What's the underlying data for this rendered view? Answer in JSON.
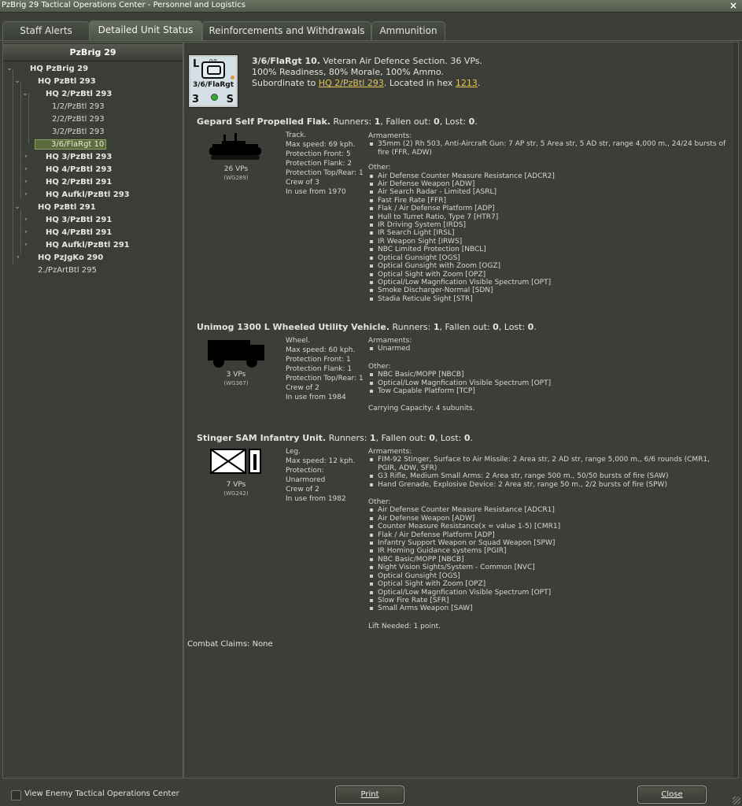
{
  "window": {
    "title": "PzBrig 29 Tactical Operations Center - Personnel and Logistics",
    "close": "×"
  },
  "tabs": [
    {
      "label": "Staff Alerts"
    },
    {
      "label": "Detailed Unit Status"
    },
    {
      "label": "Reinforcements and Withdrawals"
    },
    {
      "label": "Ammunition"
    }
  ],
  "tree": {
    "header": "PzBrig 29",
    "items": [
      {
        "label": "HQ PzBrig 29"
      },
      {
        "label": "HQ PzBtl 293"
      },
      {
        "label": "HQ 2/PzBtl 293"
      },
      {
        "label": "1/2/PzBtl 293"
      },
      {
        "label": "2/2/PzBtl 293"
      },
      {
        "label": "3/2/PzBtl 293"
      },
      {
        "label": "3/6/FlaRgt 10"
      },
      {
        "label": "HQ 3/PzBtl 293"
      },
      {
        "label": "HQ 4/PzBtl 293"
      },
      {
        "label": "HQ 2/PzBtl 291"
      },
      {
        "label": "HQ Aufkl/PzBtl 293"
      },
      {
        "label": "HQ PzBtl 291"
      },
      {
        "label": "HQ 3/PzBtl 291"
      },
      {
        "label": "HQ 4/PzBtl 291"
      },
      {
        "label": "HQ Aufkl/PzBtl 291"
      },
      {
        "label": "HQ PzJgKo 290"
      },
      {
        "label": "2./PzArtBtl 295"
      }
    ]
  },
  "unit": {
    "counter": {
      "top_left": "L",
      "name": "3/6/FlaRgt",
      "bottom_left": "3",
      "bottom_right": "S",
      "dots": "oo"
    },
    "name": "3/6/FlaRgt 10.",
    "desc": " Veteran Air Defence Section. 36 VPs.",
    "status": "100% Readiness, 80% Morale, 100% Ammo.",
    "subordinate_prefix": "Subordinate to ",
    "parent_link": "HQ 2/PzBtl 293",
    "hex_prefix": ". Located in hex ",
    "hex_link": "1213",
    "hex_suffix": "."
  },
  "vehicles": [
    {
      "name": "Gepard Self Propelled Flak.",
      "runners_label": " Runners: ",
      "runners": "1",
      "fallen_label": ", Fallen out: ",
      "fallen": "0",
      "lost_label": ", Lost: ",
      "lost": "0",
      "end": ".",
      "vps": "26 VPs",
      "wg": "(WG289)",
      "specs": [
        "Track.",
        "Max speed: 69 kph.",
        "Protection Front: 5",
        "Protection Flank: 2",
        "Protection Top/Rear: 1",
        "Crew of 3",
        "In use from 1970"
      ],
      "armaments_label": "Armaments:",
      "armaments": [
        "35mm (2) Rh 503, Anti-Aircraft Gun: 7 AP str, 5 Area str, 5 AD str, range 4,000 m., 24/24 bursts of fire (FFR, ADW)"
      ],
      "other_label": "Other:",
      "other": [
        "Air Defense Counter Measure Resistance [ADCR2]",
        "Air Defense Weapon [ADW]",
        "Air Search Radar - Limited [ASRL]",
        "Fast Fire Rate [FFR]",
        "Flak / Air Defense Platform [ADP]",
        "Hull to Turret Ratio, Type 7 [HTR7]",
        "IR Driving System [IRDS]",
        "IR Search Light [IRSL]",
        "IR Weapon Sight [IRWS]",
        "NBC Limited Protection [NBCL]",
        "Optical Gunsight [OGS]",
        "Optical Gunsight with Zoom [OGZ]",
        "Optical Sight with Zoom [OPZ]",
        "Optical/Low Magnfication Visible Spectrum [OPT]",
        "Smoke Discharger-Normal [SDN]",
        "Stadia Reticule Sight [STR]"
      ]
    },
    {
      "name": "Unimog 1300 L Wheeled Utility Vehicle.",
      "runners_label": " Runners: ",
      "runners": "1",
      "fallen_label": ", Fallen out: ",
      "fallen": "0",
      "lost_label": ", Lost: ",
      "lost": "0",
      "end": ".",
      "vps": "3 VPs",
      "wg": "(WG367)",
      "specs": [
        "Wheel.",
        "Max speed: 60 kph.",
        "Protection Front: 1",
        "Protection Flank: 1",
        "Protection Top/Rear: 1",
        "Crew of 2",
        "In use from 1984"
      ],
      "armaments_label": "Armaments:",
      "armaments": [
        "Unarmed"
      ],
      "other_label": "Other:",
      "other": [
        "NBC Basic/MOPP [NBCB]",
        "Optical/Low Magnfication Visible Spectrum [OPT]",
        "Tow Capable Platform [TCP]"
      ],
      "extra": "Carrying Capacity: 4 subunits."
    },
    {
      "name": "Stinger SAM Infantry Unit.",
      "runners_label": " Runners: ",
      "runners": "1",
      "fallen_label": ", Fallen out: ",
      "fallen": "0",
      "lost_label": ", Lost: ",
      "lost": "0",
      "end": ".",
      "vps": "7 VPs",
      "wg": "(WG242)",
      "specs": [
        "Leg.",
        "Max speed: 12 kph.",
        "Protection: Unarmored",
        "Crew of 2",
        "In use from 1982"
      ],
      "armaments_label": "Armaments:",
      "armaments": [
        "FIM-92 Stinger, Surface to Air Missile: 2 Area str, 2 AD str, range 5,000 m., 6/6 rounds (CMR1, PGIR, ADW, SFR)",
        "G3 Rifle, Medium Small Arms: 2 Area str, range 500 m., 50/50 bursts of fire (SAW)",
        "Hand Grenade, Explosive Device: 2 Area str, range 50 m., 2/2 bursts of fire (SPW)"
      ],
      "other_label": "Other:",
      "other": [
        "Air Defense Counter Measure Resistance [ADCR1]",
        "Air Defense Weapon [ADW]",
        "Counter Measure Resistance(x = value 1-5) [CMR1]",
        "Flak / Air Defense Platform [ADP]",
        "Infantry Support Weapon or Squad Weapon [SPW]",
        "IR Homing Guidance systems [PGIR]",
        "NBC Basic/MOPP [NBCB]",
        "Night Vision Sights/System - Common [NVC]",
        "Optical Gunsight [OGS]",
        "Optical Sight with Zoom [OPZ]",
        "Optical/Low Magnfication Visible Spectrum [OPT]",
        "Slow Fire Rate [SFR]",
        "Small Arms Weapon [SAW]"
      ],
      "extra": "Lift Needed: 1 point."
    }
  ],
  "combat_claims": "Combat Claims: None",
  "footer": {
    "view_enemy_label": "View Enemy Tactical Operations Center",
    "print_label": "Print",
    "close_label": "Close"
  }
}
